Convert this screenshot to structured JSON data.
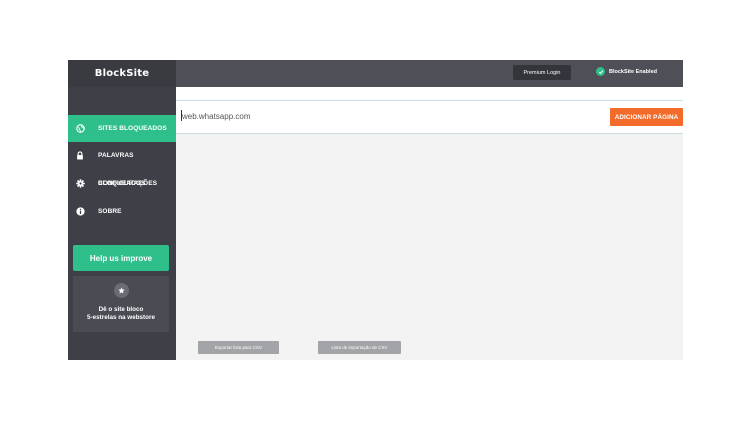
{
  "sidebar": {
    "brand": "BlockSite",
    "items": [
      {
        "label": "SITES BLOQUEADOS",
        "icon": "globe-icon",
        "active": true
      },
      {
        "label": "PALAVRAS",
        "icon": "lock-icon",
        "active": false
      },
      {
        "label": "BLOQUEADOS",
        "label_overlap": "CONFIGURAÇÕES",
        "icon": "gear-icon",
        "active": false
      },
      {
        "label": "SOBRE",
        "icon": "info-icon",
        "active": false
      }
    ],
    "help_button": "Help us improve",
    "rate_card": {
      "icon": "star-icon",
      "line1": "Dê o site bloco",
      "line2": "5-estrelas na webstore"
    }
  },
  "topbar": {
    "premium_login": "Premium Login",
    "status_text": "BlockSite Enabled",
    "status_icon": "check-circle-icon"
  },
  "main": {
    "url_input_value": "web.whatsapp.com",
    "add_button": "ADICIONAR PÁGINA",
    "export_csv": "Exportar lista para CSV",
    "import_csv": "Lista de importação de CSV"
  },
  "colors": {
    "sidebar_bg": "#3f4047",
    "topbar_bg": "#4e4f57",
    "accent_green": "#2fbf8a",
    "accent_orange": "#f26b2a",
    "csv_button": "#a3a4a8"
  }
}
